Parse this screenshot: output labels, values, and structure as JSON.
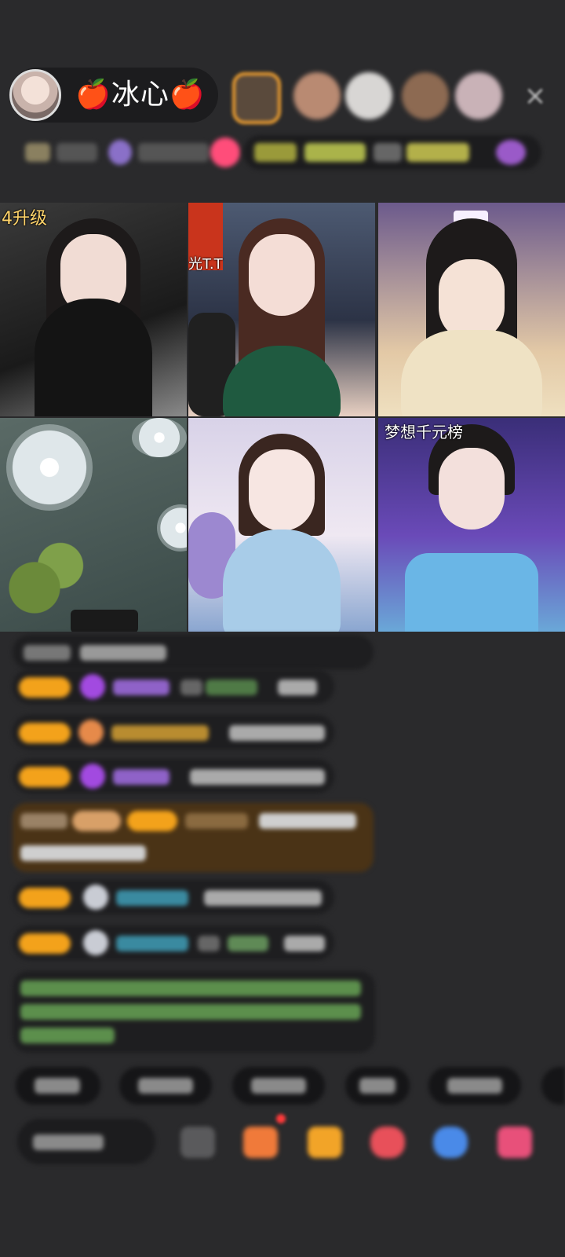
{
  "header": {
    "host_name": "🍎冰心🍎",
    "close_icon": "×"
  },
  "grid": {
    "tiles": [
      {
        "label": "4升级"
      },
      {
        "label": "光T.T"
      },
      {
        "label": ""
      },
      {
        "label": ""
      },
      {
        "label": ""
      },
      {
        "label": "梦想千元榜"
      }
    ]
  },
  "colors": {
    "background": "#2a2a2c",
    "badge_gold": "#f3a21b",
    "chat_highlight": "#4a3316",
    "notification_dot": "#ff3a3a"
  }
}
